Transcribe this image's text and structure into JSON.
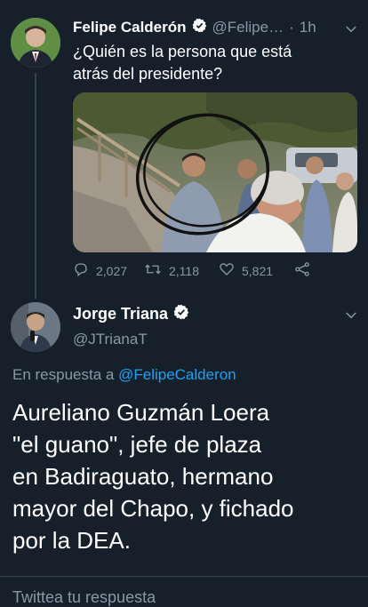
{
  "colors": {
    "background": "#15202b",
    "text": "#ffffff",
    "muted": "#8899a6",
    "link": "#1da1f2",
    "verified": "#ffffff",
    "divider": "#38444d"
  },
  "tweet1": {
    "author_name": "Felipe Calderón",
    "handle": "@Felipe…",
    "separator": "·",
    "time": "1h",
    "text_line1": "¿Quién es la persona que está",
    "text_line2": "atrás del presidente?",
    "stats": {
      "replies": "2,027",
      "retweets": "2,118",
      "likes": "5,821"
    },
    "icons": {
      "reply": "reply-icon",
      "retweet": "retweet-icon",
      "like": "heart-icon",
      "share": "share-icon",
      "menu": "chevron-down-icon"
    }
  },
  "tweet2": {
    "author_name": "Jorge Triana",
    "handle": "@JTrianaT",
    "reply_prefix": "En respuesta a",
    "reply_to": "@FelipeCalderon",
    "body_lines": [
      "Aureliano Guzmán Loera",
      "\"el guano\", jefe de plaza",
      "en Badiraguato, hermano",
      "mayor del Chapo, y fichado",
      "por la DEA."
    ]
  },
  "composer": {
    "placeholder": "Twittea tu respuesta"
  }
}
